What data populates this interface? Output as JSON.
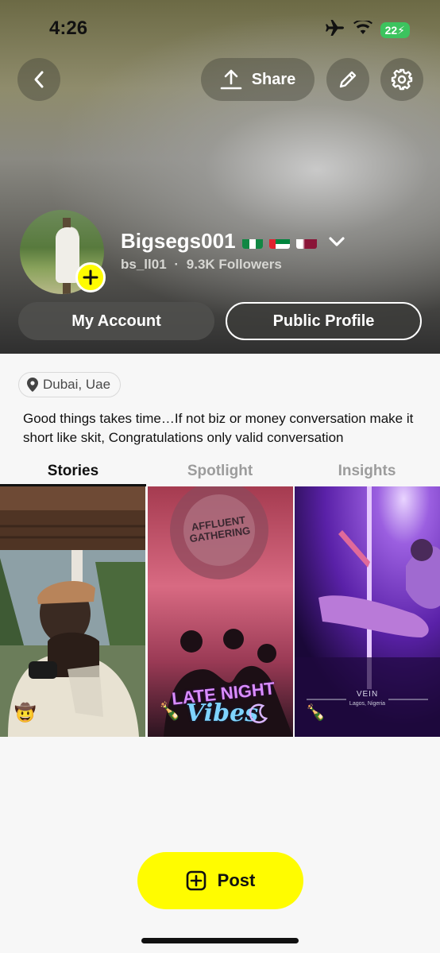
{
  "status_bar": {
    "time": "4:26",
    "battery": "22"
  },
  "header": {
    "share_label": "Share"
  },
  "profile": {
    "display_name": "Bigsegs001",
    "username": "bs_ll01",
    "separator": "·",
    "followers": "9.3K Followers",
    "flags": [
      "nigeria",
      "uae",
      "qatar"
    ]
  },
  "buttons": {
    "my_account": "My Account",
    "public_profile": "Public Profile"
  },
  "location": "Dubai, Uae",
  "bio": "Good things takes time…If not biz or money conversation make it short like skit, Congratulations only valid conversation",
  "tabs": [
    "Stories",
    "Spotlight",
    "Insights"
  ],
  "active_tab": "Stories",
  "thumbnails": [
    {
      "emoji": "🤠"
    },
    {
      "sign_top": "AFFLUENT GATHERING",
      "caption_line1": "LATE NIGHT",
      "caption_line2": "Vibes",
      "emoji": "🍾"
    },
    {
      "caption": "VEIN",
      "sub": "Lagos, Nigeria",
      "emoji": "🍾"
    }
  ],
  "post_label": "Post",
  "colors": {
    "accent_yellow": "#fffc00",
    "battery_green": "#3cc35e"
  }
}
